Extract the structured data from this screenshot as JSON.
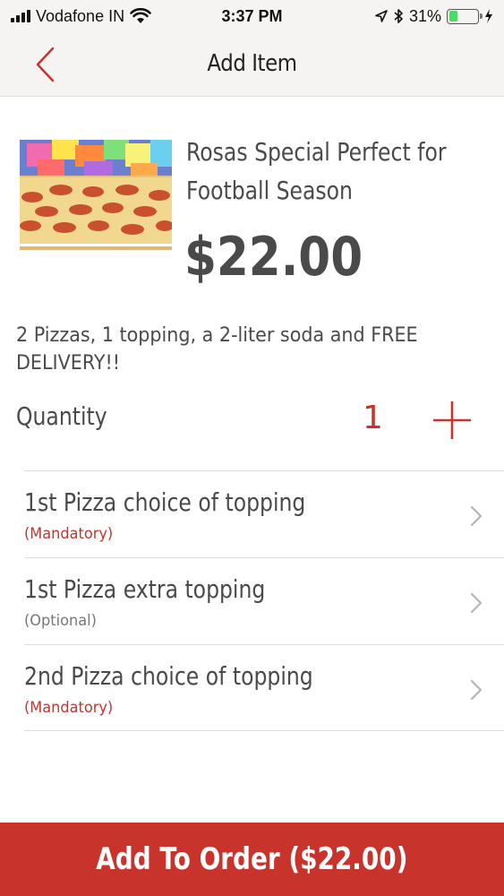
{
  "status_bar": {
    "carrier": "Vodafone IN",
    "time": "3:37 PM",
    "battery": "31%",
    "battery_level": 0.31,
    "icons": [
      "signal-icon",
      "wifi-icon",
      "location-icon",
      "bluetooth-icon",
      "battery-icon",
      "charging-icon"
    ]
  },
  "nav": {
    "title": "Add Item",
    "back_icon": "back-chevron-icon"
  },
  "product": {
    "title": "Rosas Special Perfect for Football Season",
    "price": "$22.00",
    "description": "2 Pizzas, 1 topping, a 2-liter soda and FREE DELIVERY!!"
  },
  "quantity": {
    "label": "Quantity",
    "value": "1"
  },
  "options": [
    {
      "title": "1st Pizza choice of topping",
      "requirement": "(Mandatory)"
    },
    {
      "title": "1st Pizza extra topping",
      "requirement": "(Optional)"
    },
    {
      "title": "2nd Pizza choice of topping",
      "requirement": "(Mandatory)"
    }
  ],
  "add_button": {
    "label": "Add To Order ($22.00)"
  },
  "colors": {
    "accent": "#c8332b",
    "nav_background": "#f6f4f2",
    "text": "#4a4a4a"
  }
}
